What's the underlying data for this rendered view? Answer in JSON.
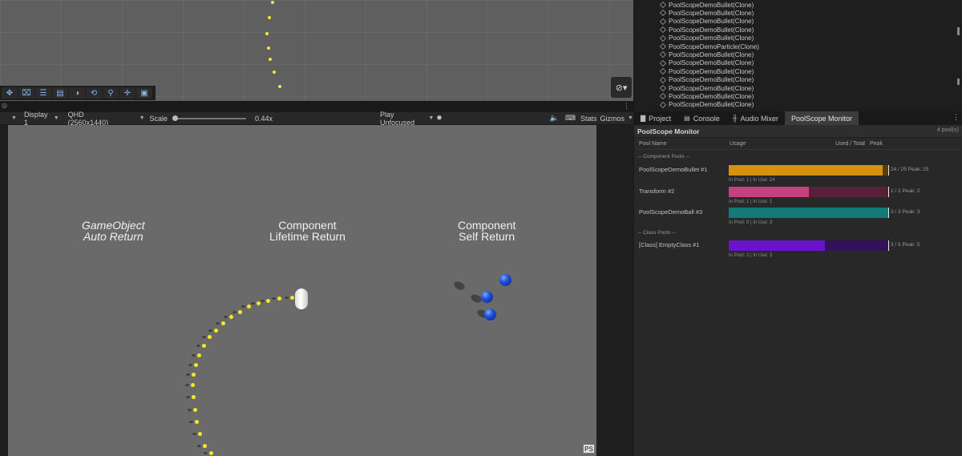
{
  "scene": {
    "toolbar_tools": [
      "move-tool-icon",
      "rect-tool-icon",
      "sliders-icon",
      "panel-icon",
      "circle-tool-icon",
      "pivot-icon",
      "zoom-icon",
      "move-arrows-icon",
      "layers-icon"
    ]
  },
  "game": {
    "toolbar": {
      "display": "Display 1",
      "resolution": "QHD (2560x1440)",
      "scale_label": "Scale",
      "scale_value": "0.44x",
      "play_mode": "Play Unfocused",
      "stats": "Stats",
      "gizmos": "Gizmos"
    },
    "labels": {
      "auto_return_l1": "GameObject",
      "auto_return_l2": "Auto Return",
      "lifetime_l1": "Component",
      "lifetime_l2": "Lifetime Return",
      "self_l1": "Component",
      "self_l2": "Self Return"
    },
    "ps_badge": "PS"
  },
  "hierarchy": {
    "items": [
      "PoolScopeDemoBullet(Clone)",
      "PoolScopeDemoBullet(Clone)",
      "PoolScopeDemoBullet(Clone)",
      "PoolScopeDemoBullet(Clone)",
      "PoolScopeDemoBullet(Clone)",
      "PoolScopeDemoParticle(Clone)",
      "PoolScopeDemoBullet(Clone)",
      "PoolScopeDemoBullet(Clone)",
      "PoolScopeDemoBullet(Clone)",
      "PoolScopeDemoBullet(Clone)",
      "PoolScopeDemoBullet(Clone)",
      "PoolScopeDemoBullet(Clone)",
      "PoolScopeDemoBullet(Clone)"
    ]
  },
  "panel_tabs": [
    {
      "label": "Project",
      "icon": "folder-icon"
    },
    {
      "label": "Console",
      "icon": "console-icon"
    },
    {
      "label": "Audio Mixer",
      "icon": "audio-mixer-icon"
    },
    {
      "label": "PoolScope Monitor",
      "icon": ""
    }
  ],
  "monitor": {
    "title": "PoolScope Monitor",
    "pool_count": "4 pool(s)",
    "columns": {
      "name": "Pool Name",
      "usage": "Usage",
      "used_total": "Used / Total",
      "peak": "Peak"
    },
    "sections": {
      "component": "-- Component Pools --",
      "class": "-- Class Pools --"
    },
    "pools": [
      {
        "name": "PoolScopeDemoBullet #1",
        "stat": "24 / 25   Peak: 25",
        "sub": "In Pool: 1  |  In Use: 24",
        "used": 24,
        "total": 25,
        "peak": 25,
        "color": "#d6920e",
        "track": "#5a3d0a"
      },
      {
        "name": "Transform #2",
        "stat": "1 / 2   Peak: 2",
        "sub": "In Pool: 1  |  In Use: 1",
        "used": 1,
        "total": 2,
        "peak": 2,
        "color": "#c7417e",
        "track": "#5a2038"
      },
      {
        "name": "PoolScopeDemoBall #3",
        "stat": "3 / 3   Peak: 3",
        "sub": "In Pool: 0  |  In Use: 3",
        "used": 3,
        "total": 3,
        "peak": 3,
        "color": "#147a78",
        "track": "#0c3f3e"
      },
      {
        "name": "[Class] EmptyClass #1",
        "stat": "3 / 5   Peak: 5",
        "sub": "In Pool: 2  |  In Use: 3",
        "used": 3,
        "total": 5,
        "peak": 5,
        "color": "#6a12cc",
        "track": "#33125a"
      }
    ]
  }
}
